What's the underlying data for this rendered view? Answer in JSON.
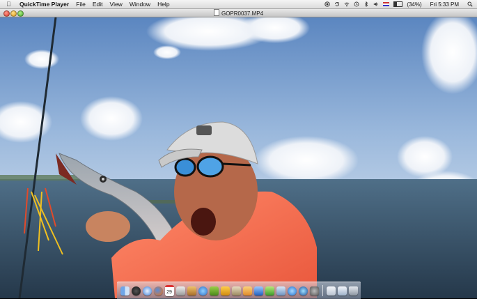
{
  "menubar": {
    "apple_icon": "apple-icon",
    "app_name": "QuickTime Player",
    "menus": [
      "File",
      "Edit",
      "View",
      "Window",
      "Help"
    ],
    "status": {
      "battery_text": "(34%)",
      "battery_level": 0.34,
      "clock": "Fri 5:33 PM",
      "icons": [
        "record-icon",
        "sync-icon",
        "wifi-icon",
        "time-machine-icon",
        "bluetooth-icon",
        "volume-icon",
        "flag-icon",
        "battery-icon",
        "spotlight-icon"
      ]
    }
  },
  "window": {
    "title": "GOPR0037.MP4"
  },
  "dock": {
    "icons": [
      "finder-icon",
      "dashboard-icon",
      "safari-icon",
      "firefox-icon",
      "calendar-icon",
      "ical-icon",
      "iphoto-icon",
      "itunes-icon",
      "garageband-icon",
      "imovie-icon",
      "iweb-icon",
      "pages-icon",
      "keynote-icon",
      "numbers-icon",
      "preview-icon",
      "app-store-icon",
      "quicktime-icon",
      "system-preferences-icon",
      "documents-icon",
      "downloads-icon",
      "trash-icon"
    ],
    "calendar_day": "29"
  }
}
